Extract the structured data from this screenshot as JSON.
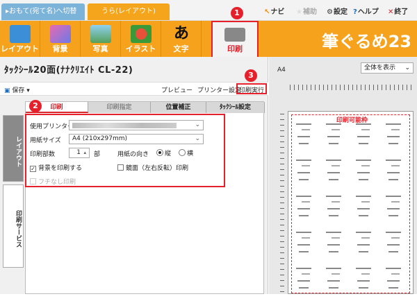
{
  "tabs": {
    "front": "▸おもて(宛て名)へ切替",
    "back": "うら(レイアウト)"
  },
  "top_menu": [
    {
      "icon": "↖",
      "label": "ナビ",
      "color": "#f08a00"
    },
    {
      "icon": "★",
      "label": "補助",
      "color": "#ccc"
    },
    {
      "icon": "⚙",
      "label": "設定",
      "color": "#555"
    },
    {
      "icon": "?",
      "label": "ヘルプ",
      "color": "#1a6fc0"
    },
    {
      "icon": "✕",
      "label": "終了",
      "color": "#d8232a"
    }
  ],
  "ribbon": [
    {
      "label": "レイアウト",
      "color": "#3a8fd6"
    },
    {
      "label": "背景",
      "color": "#e86ab0"
    },
    {
      "label": "写真",
      "color": "#55a05a"
    },
    {
      "label": "イラスト",
      "color": "#e8503a"
    },
    {
      "label": "文字",
      "color": "#333333"
    },
    {
      "label": "印刷",
      "color": "#888888"
    }
  ],
  "logo": "筆ぐるめ23",
  "doc_title": "ﾀｯｸｼｰﾙ20面(ﾅﾅｸﾘｴｲﾄ CL-22)",
  "toolbar": {
    "save": "保存",
    "preview": "プレビュー",
    "printer_settings": "プリンター設定",
    "execute": "印刷実行"
  },
  "side_tabs": {
    "layout": "レイアウト",
    "print_service": "印刷サービス"
  },
  "panel_tabs": {
    "print": "印刷",
    "spec": "印刷指定",
    "pos": "位置補正",
    "tack": "ﾀｯｸｼｰﾙ設定"
  },
  "form": {
    "printer_label": "使用プリンター",
    "paper_label": "用紙サイズ",
    "paper_value": "A4 (210x297mm)",
    "copies_label": "印刷部数",
    "copies_value": "1",
    "copies_unit": "部",
    "orientation_label": "用紙の向き",
    "portrait": "縦",
    "landscape": "横",
    "bg_print": "背景を印刷する",
    "mirror": "鏡面（左右反転）印刷",
    "borderless": "フチなし印刷"
  },
  "preview": {
    "page_size": "A4",
    "zoom": "全体を表示",
    "printable": "印刷可能枠"
  },
  "badges": [
    "1",
    "2",
    "3"
  ],
  "accent": "#f6a21c",
  "highlight": "#e6202a"
}
